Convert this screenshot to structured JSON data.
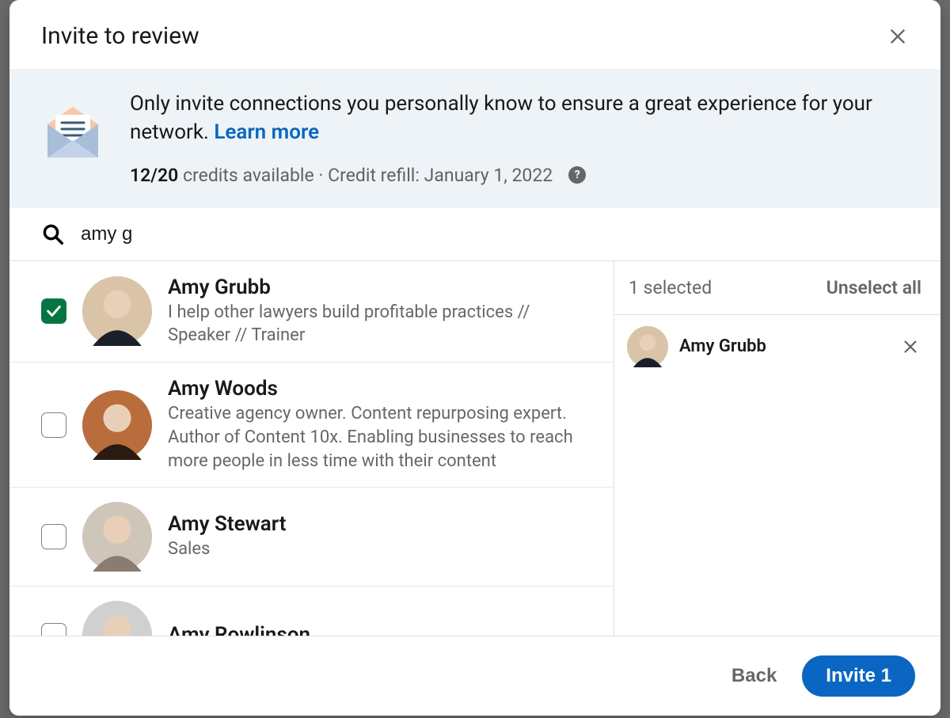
{
  "modal": {
    "title": "Invite to review"
  },
  "banner": {
    "message_prefix": "Only invite connections you personally know to ensure a great experience for your network. ",
    "learn_more": "Learn more",
    "credits_strong": "12/20",
    "credits_text": " credits available · Credit refill: January 1, 2022"
  },
  "search": {
    "value": "amy g"
  },
  "results": [
    {
      "name": "Amy Grubb",
      "headline": "I help other lawyers build profitable practices // Speaker // Trainer",
      "checked": true,
      "avatar_colors": [
        "#d9c4a8",
        "#1b1f2a"
      ]
    },
    {
      "name": "Amy Woods",
      "headline": "Creative agency owner. Content repurposing expert. Author of Content 10x. Enabling businesses to reach more people in less time with their content",
      "checked": false,
      "avatar_colors": [
        "#b96d3c",
        "#2b1a12"
      ]
    },
    {
      "name": "Amy Stewart",
      "headline": "Sales",
      "checked": false,
      "avatar_colors": [
        "#cfc6ba",
        "#8a7d6f"
      ]
    },
    {
      "name": "Amy Rowlinson",
      "headline": "",
      "checked": false,
      "avatar_colors": [
        "#d0d0d0",
        "#a0a0a0"
      ]
    }
  ],
  "selected": {
    "count_label": "1 selected",
    "unselect_label": "Unselect all",
    "items": [
      {
        "name": "Amy Grubb",
        "avatar_colors": [
          "#d9c4a8",
          "#1b1f2a"
        ]
      }
    ]
  },
  "footer": {
    "back": "Back",
    "invite": "Invite 1"
  }
}
